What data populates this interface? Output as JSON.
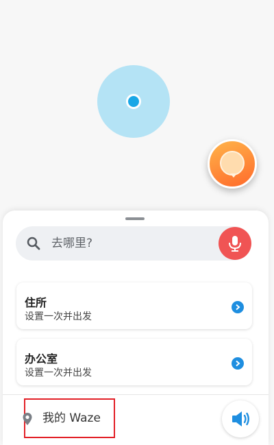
{
  "map": {
    "location_icon": "current-location-dot"
  },
  "fab": {
    "icon": "waze-character-icon",
    "color": "#ff8c36"
  },
  "search": {
    "placeholder": "去哪里?",
    "icon": "search-icon",
    "mic_icon": "microphone-icon",
    "mic_color": "#f05454"
  },
  "places": [
    {
      "title": "住所",
      "subtitle": "设置一次并出发",
      "icon": "chevron-right-icon"
    },
    {
      "title": "办公室",
      "subtitle": "设置一次并出发",
      "icon": "chevron-right-icon"
    }
  ],
  "bottom": {
    "my_waze_label": "我的 Waze",
    "pin_icon": "map-pin-icon",
    "sound_icon": "speaker-icon",
    "highlight_color": "#e21f26"
  }
}
